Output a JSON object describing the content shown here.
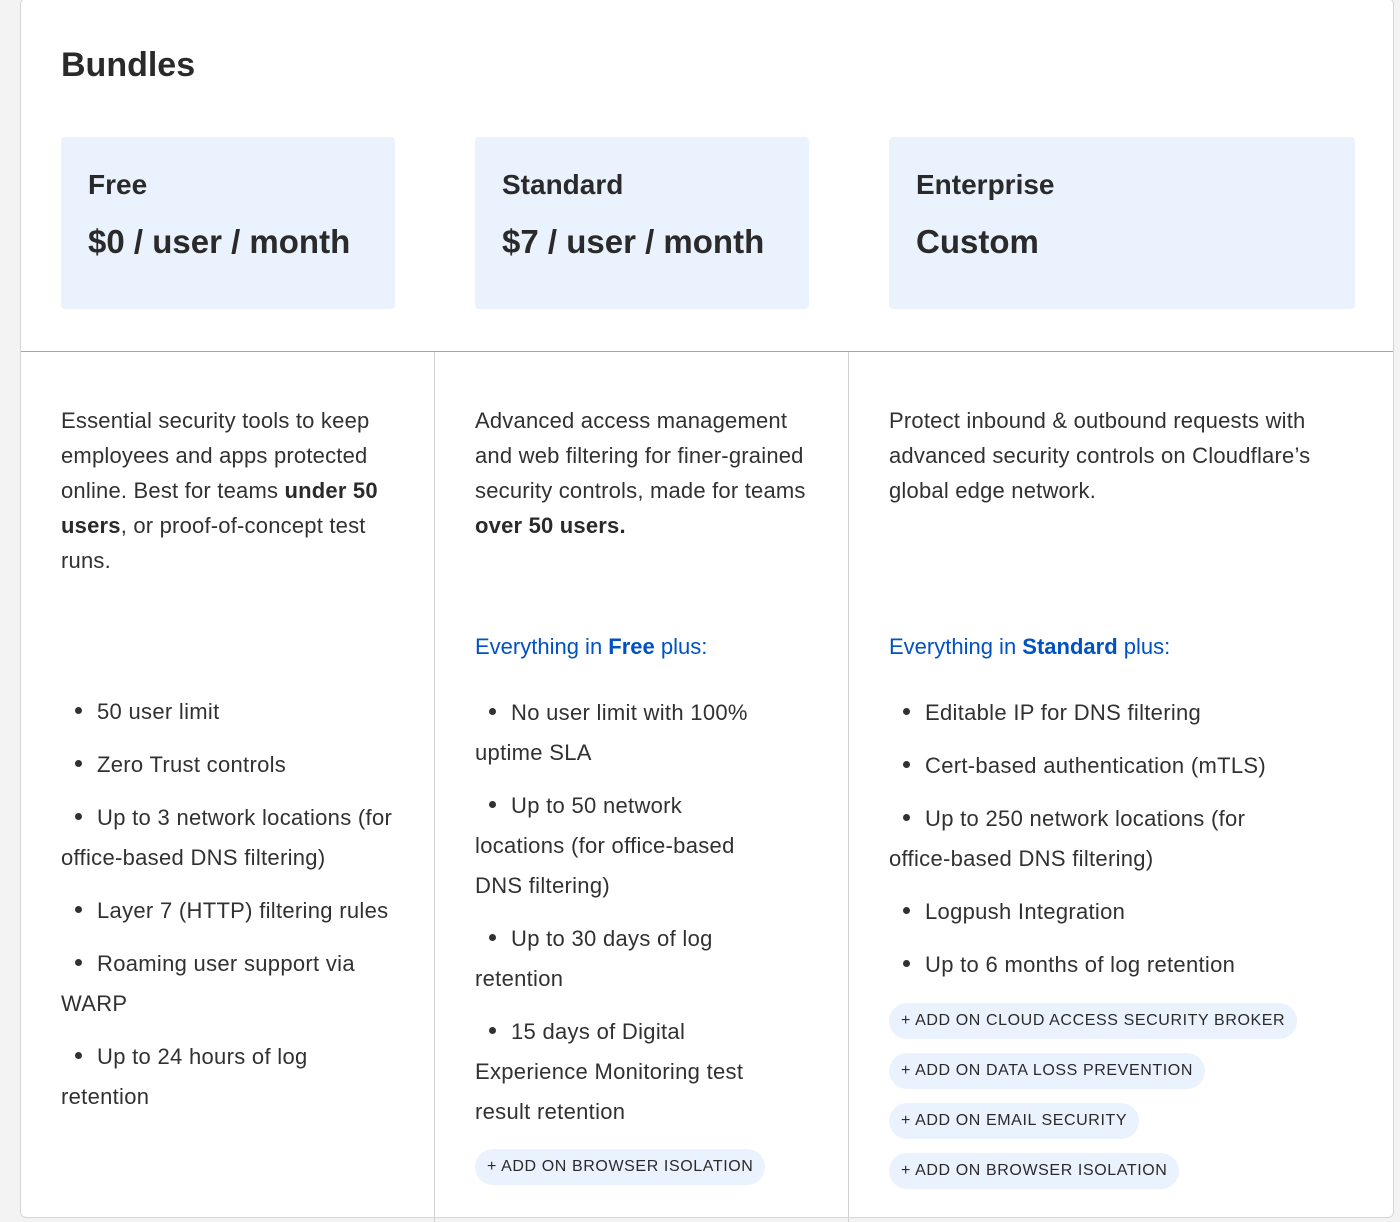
{
  "title": "Bundles",
  "plans": [
    {
      "name": "Free",
      "price": "$0 / user / month",
      "description_parts": [
        "Essential security tools to keep employees and apps protected online. Best for teams ",
        "under 50 users",
        ", or proof-of-concept test runs."
      ],
      "features": [
        "50 user limit",
        "Zero Trust controls",
        "Up to 3 network locations (for office-based DNS filtering)",
        "Layer 7 (HTTP) filtering rules",
        "Roaming user support via WARP",
        "Up to 24 hours of log retention"
      ],
      "addons": []
    },
    {
      "name": "Standard",
      "price": "$7 / user / month",
      "description_parts": [
        "Advanced access management and web filtering for finer-grained security controls, made for teams ",
        "over 50 users.",
        ""
      ],
      "lead_parts": [
        "Everything in ",
        "Free",
        " plus:"
      ],
      "features": [
        "No user limit with 100% uptime SLA",
        "Up to 50 network locations (for office-based DNS filtering)",
        "Up to 30 days of log retention",
        "15 days of Digital Experience Monitoring test result retention"
      ],
      "addons": [
        "+ ADD ON BROWSER ISOLATION"
      ]
    },
    {
      "name": "Enterprise",
      "price": "Custom",
      "description_parts": [
        "Protect inbound & outbound requests with advanced security controls on Cloudflare’s global edge network.",
        "",
        ""
      ],
      "lead_parts": [
        "Everything in ",
        "Standard",
        " plus:"
      ],
      "features": [
        "Editable IP for DNS filtering",
        "Cert-based authentication (mTLS)",
        "Up to 250 network locations (for office-based DNS filtering)",
        "Logpush Integration",
        "Up to 6 months of log retention"
      ],
      "addons": [
        "+ ADD ON CLOUD ACCESS SECURITY BROKER",
        "+ ADD ON DATA LOSS PREVENTION",
        "+ ADD ON EMAIL SECURITY",
        "+ ADD ON BROWSER ISOLATION"
      ]
    }
  ],
  "colors": {
    "plan_header_bg": "#eaf2fd",
    "accent_link": "#0051c3",
    "text": "#313131"
  }
}
